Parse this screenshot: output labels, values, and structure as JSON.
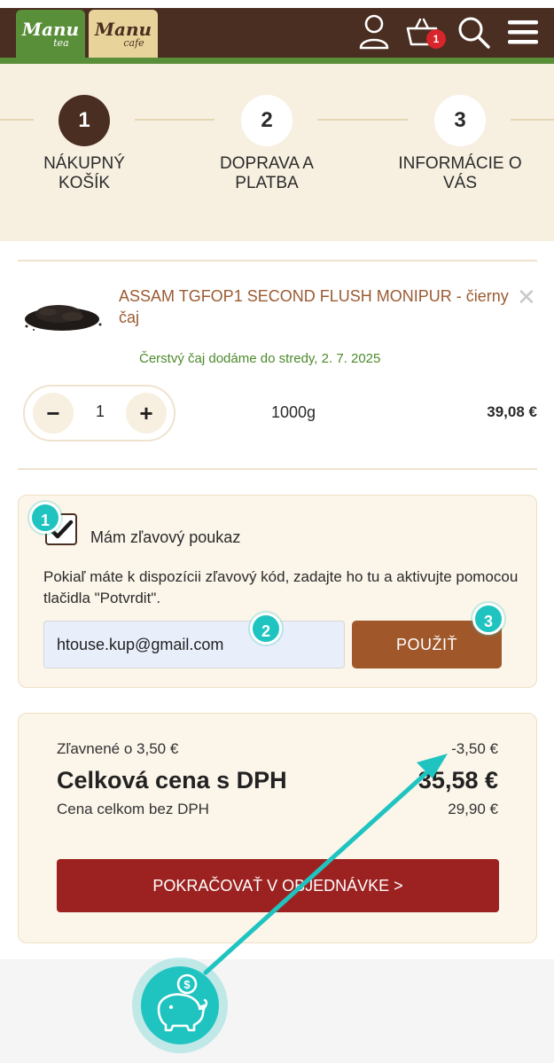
{
  "header": {
    "logo_tea": {
      "main": "Manu",
      "sub": "tea"
    },
    "logo_cafe": {
      "main": "Manu",
      "sub": "cafe"
    },
    "cart_count": "1",
    "icons": [
      "user-icon",
      "basket-icon",
      "search-icon",
      "menu-icon"
    ]
  },
  "steps": [
    {
      "number": "1",
      "label": "NÁKUPNÝ\nKOŠÍK",
      "active": true
    },
    {
      "number": "2",
      "label": "DOPRAVA A\nPLATBA",
      "active": false
    },
    {
      "number": "3",
      "label": "INFORMÁCIE O\nVÁS",
      "active": false
    }
  ],
  "cart_item": {
    "title": "ASSAM TGFOP1 SECOND FLUSH MONIPUR - čierny čaj",
    "delivery": "Čerstvý čaj dodáme do stredy, 2. 7. 2025",
    "quantity": "1",
    "weight": "1000g",
    "price": "39,08 €",
    "remove": "✕"
  },
  "voucher": {
    "title": "Mám zľavový poukaz",
    "description": "Pokiaľ máte k dispozícii zľavový kód, zadajte ho tu a aktivujte pomocou tlačidla \"Potvrdit\".",
    "input_value": "htouse.kup@gmail.com",
    "apply_label": "POUŽIŤ",
    "checked": true
  },
  "summary": {
    "discount_label": "Zľavnené o 3,50 €",
    "discount_value": "-3,50 €",
    "total_label": "Celková cena s DPH",
    "total_value": "35,58 €",
    "net_label": "Cena celkom bez DPH",
    "net_value": "29,90 €",
    "continue_label": "POKRAČOVAŤ V OBJEDNÁVKE  >"
  },
  "tutorial": {
    "markers": [
      "1",
      "2",
      "3"
    ],
    "accent": "#1fc4c0"
  },
  "colors": {
    "brand_brown": "#4a2e21",
    "brand_green": "#5a8f3a",
    "apply_button": "#a0582b",
    "continue_button": "#9c2221"
  }
}
